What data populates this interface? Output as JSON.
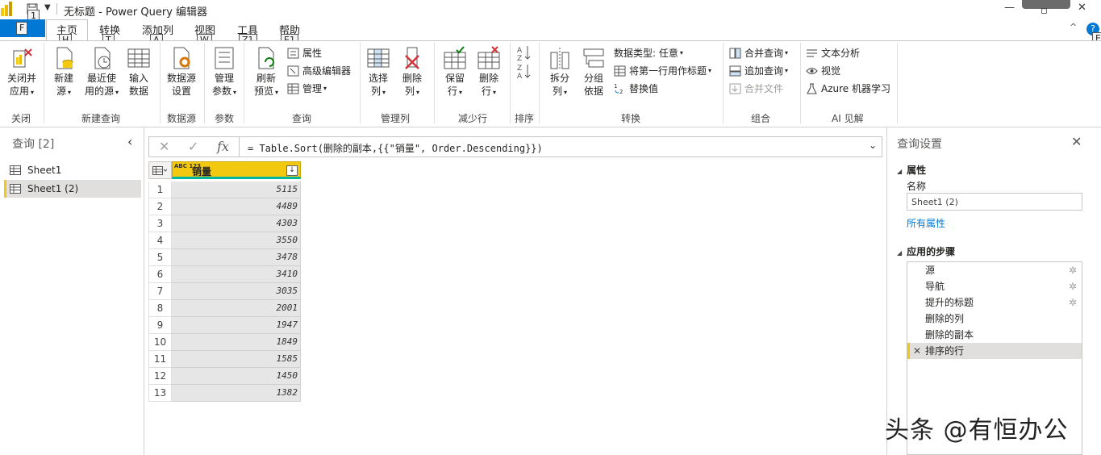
{
  "window": {
    "title": "无标题 - Power Query 编辑器",
    "minimize": "—",
    "close": "✕"
  },
  "keytips": {
    "qat_save": "1",
    "file": "F",
    "home": "H",
    "transform": "T",
    "add_column": "A",
    "view": "W",
    "tools": "Z1",
    "help": "E1",
    "help_icon": "E"
  },
  "tabs": {
    "file": "文件",
    "items": [
      "主页",
      "转换",
      "添加列",
      "视图",
      "工具",
      "帮助"
    ]
  },
  "ribbon": {
    "groups": [
      "关闭",
      "新建查询",
      "数据源",
      "参数",
      "查询",
      "管理列",
      "减少行",
      "排序",
      "转换",
      "组合",
      "AI 见解"
    ],
    "close_apply": [
      "关闭并",
      "应用"
    ],
    "new_source": [
      "新建",
      "源"
    ],
    "recent_sources": [
      "最近使",
      "用的源"
    ],
    "enter_data": [
      "输入",
      "数据"
    ],
    "data_source_settings": [
      "数据源",
      "设置"
    ],
    "manage_params": [
      "管理",
      "参数"
    ],
    "refresh_preview": [
      "刷新",
      "预览"
    ],
    "properties": "属性",
    "advanced_editor": "高级编辑器",
    "manage": "管理",
    "choose_columns": [
      "选择",
      "列"
    ],
    "remove_columns": [
      "删除",
      "列"
    ],
    "keep_rows": [
      "保留",
      "行"
    ],
    "remove_rows": [
      "删除",
      "行"
    ],
    "split_column": [
      "拆分",
      "列"
    ],
    "group_by": [
      "分组",
      "依据"
    ],
    "data_type": "数据类型: 任意",
    "use_first_row": "将第一行用作标题",
    "replace_values": "替换值",
    "merge_queries": "合并查询",
    "append_queries": "追加查询",
    "combine_files": "合并文件",
    "text_analytics": "文本分析",
    "vision": "视觉",
    "azure_ml": "Azure 机器学习"
  },
  "queries": {
    "header": "查询 [2]",
    "items": [
      {
        "name": "Sheet1"
      },
      {
        "name": "Sheet1 (2)"
      }
    ]
  },
  "formula": {
    "text": "= Table.Sort(删除的副本,{{\"销量\", Order.Descending}})",
    "fx": "fx"
  },
  "grid": {
    "column_type": "ABC 123",
    "column_name": "销量",
    "rows": [
      {
        "n": "1",
        "v": "5115"
      },
      {
        "n": "2",
        "v": "4489"
      },
      {
        "n": "3",
        "v": "4303"
      },
      {
        "n": "4",
        "v": "3550"
      },
      {
        "n": "5",
        "v": "3478"
      },
      {
        "n": "6",
        "v": "3410"
      },
      {
        "n": "7",
        "v": "3035"
      },
      {
        "n": "8",
        "v": "2001"
      },
      {
        "n": "9",
        "v": "1947"
      },
      {
        "n": "10",
        "v": "1849"
      },
      {
        "n": "11",
        "v": "1585"
      },
      {
        "n": "12",
        "v": "1450"
      },
      {
        "n": "13",
        "v": "1382"
      }
    ]
  },
  "settings": {
    "header": "查询设置",
    "properties_section": "属性",
    "name_label": "名称",
    "name_value": "Sheet1 (2)",
    "all_properties": "所有属性",
    "steps_section": "应用的步骤",
    "steps": [
      {
        "name": "源",
        "gear": true
      },
      {
        "name": "导航",
        "gear": true
      },
      {
        "name": "提升的标题",
        "gear": true
      },
      {
        "name": "删除的列",
        "gear": false
      },
      {
        "name": "删除的副本",
        "gear": false
      },
      {
        "name": "排序的行",
        "gear": false
      }
    ]
  },
  "watermark": "头条 @有恒办公",
  "colors": {
    "accent": "#0078d4",
    "column_header": "#f2c811",
    "quality_bar": "#00b7a0"
  }
}
